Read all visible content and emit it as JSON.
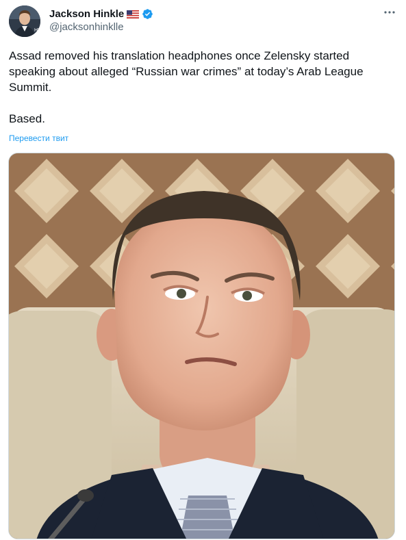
{
  "author": {
    "display_name": "Jackson Hinkle",
    "handle": "@jacksonhinklle",
    "flag_icon": "us-flag-icon",
    "verified_icon": "verified-badge-icon",
    "verified_color": "#1d9bf0"
  },
  "more_icon": "more-horizontal-icon",
  "tweet": {
    "text": "Assad removed his translation headphones once Zelensky started speaking about alleged “Russian war crimes” at today’s Arab League Summit.\n\nBased.",
    "translate_label": "Перевести твит"
  },
  "colors": {
    "text": "#0f1419",
    "secondary": "#536471",
    "link": "#1d9bf0",
    "border": "#cfd9de"
  },
  "media": {
    "type": "photo"
  }
}
